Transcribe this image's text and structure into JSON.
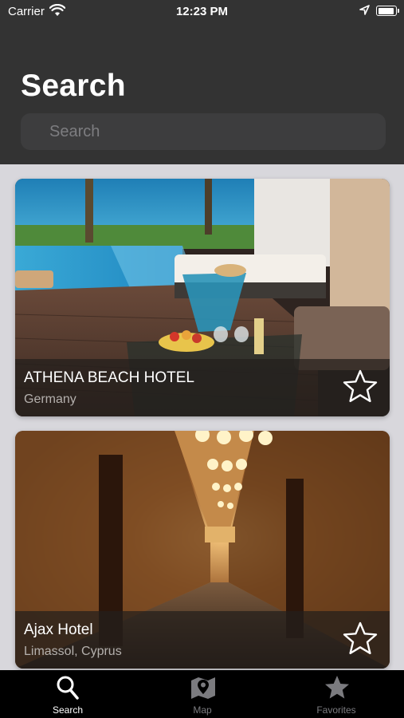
{
  "status": {
    "carrier": "Carrier",
    "time": "12:23 PM"
  },
  "header": {
    "title": "Search",
    "search_placeholder": "Search"
  },
  "hotels": [
    {
      "name": "ATHENA BEACH HOTEL",
      "location": "Germany",
      "favorite": false
    },
    {
      "name": "Ajax Hotel",
      "location": "Limassol, Cyprus",
      "favorite": false
    }
  ],
  "tabs": [
    {
      "label": "Search",
      "active": true,
      "icon": "search-icon"
    },
    {
      "label": "Map",
      "active": false,
      "icon": "map-icon"
    },
    {
      "label": "Favorites",
      "active": false,
      "icon": "star-icon"
    }
  ],
  "colors": {
    "header_bg": "#333333",
    "page_bg": "#d8d7dc",
    "tabbar_bg": "#000000"
  }
}
